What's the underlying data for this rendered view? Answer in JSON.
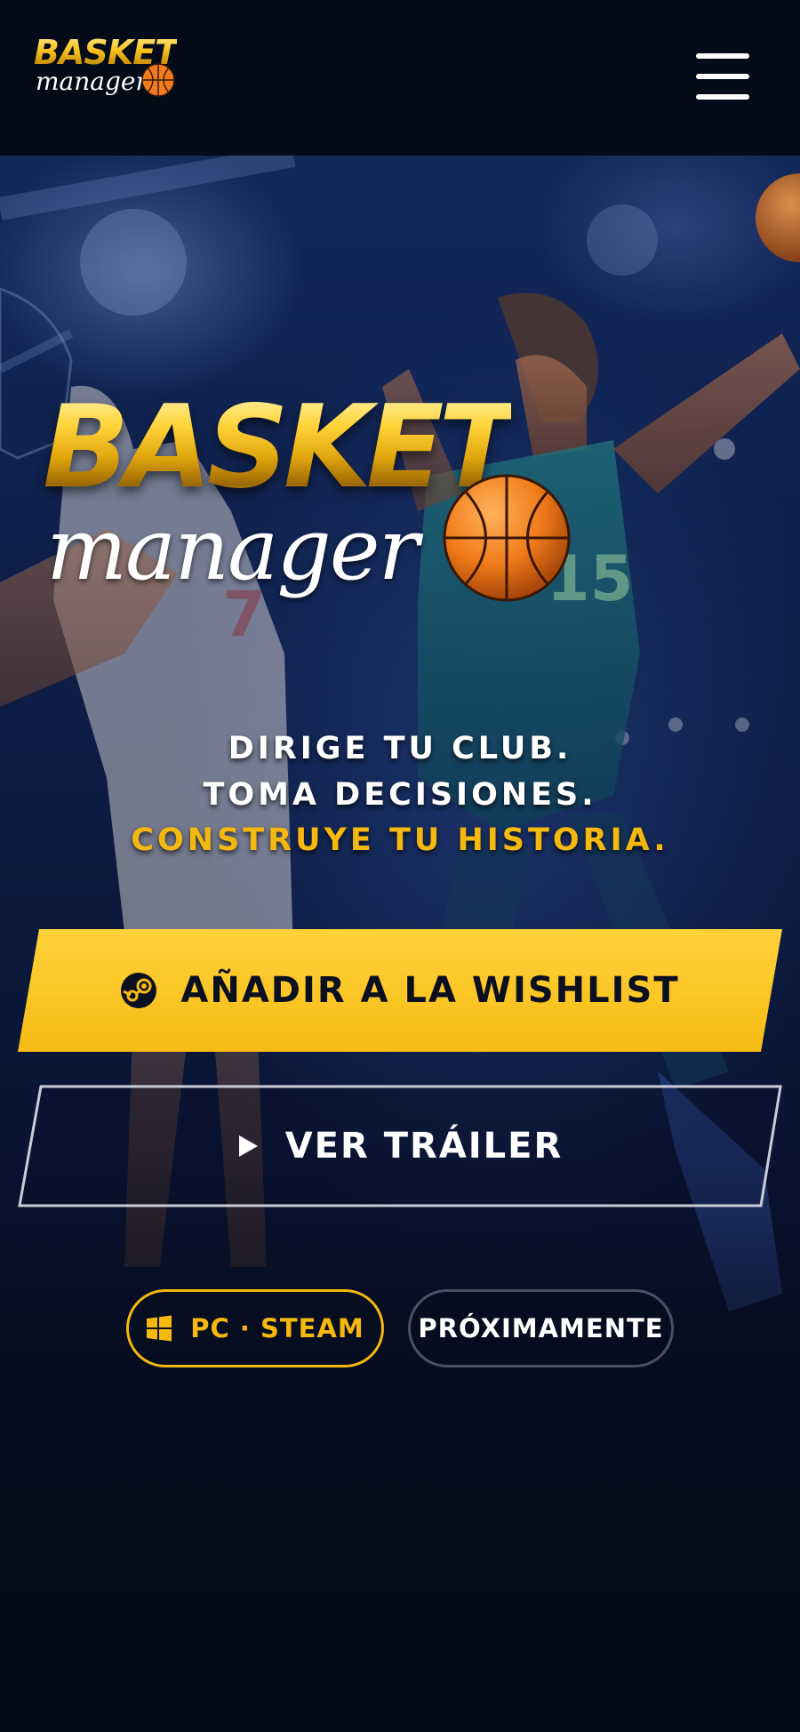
{
  "header": {
    "logo_word": "BASKET",
    "logo_script": "manager",
    "menu_icon": "hamburger-menu-icon"
  },
  "hero": {
    "logo_word": "BASKET",
    "logo_script": "manager",
    "tagline": {
      "line1": "DIRIGE TU CLUB.",
      "line2": "TOMA DECISIONES.",
      "line3": "CONSTRUYE TU HISTORIA."
    },
    "wishlist_button": {
      "label": "AÑADIR A LA WISHLIST",
      "icon": "steam-icon"
    },
    "trailer_button": {
      "label": "VER TRÁILER",
      "icon": "play-icon"
    },
    "platform_pill": {
      "label": "PC · STEAM",
      "icon": "windows-icon"
    },
    "status_pill": {
      "label": "PRÓXIMAMENTE"
    }
  },
  "colors": {
    "accent_yellow": "#f5b80f",
    "background_navy": "#060c1e",
    "text_white": "#ffffff",
    "button_text_dark": "#0b1020"
  }
}
